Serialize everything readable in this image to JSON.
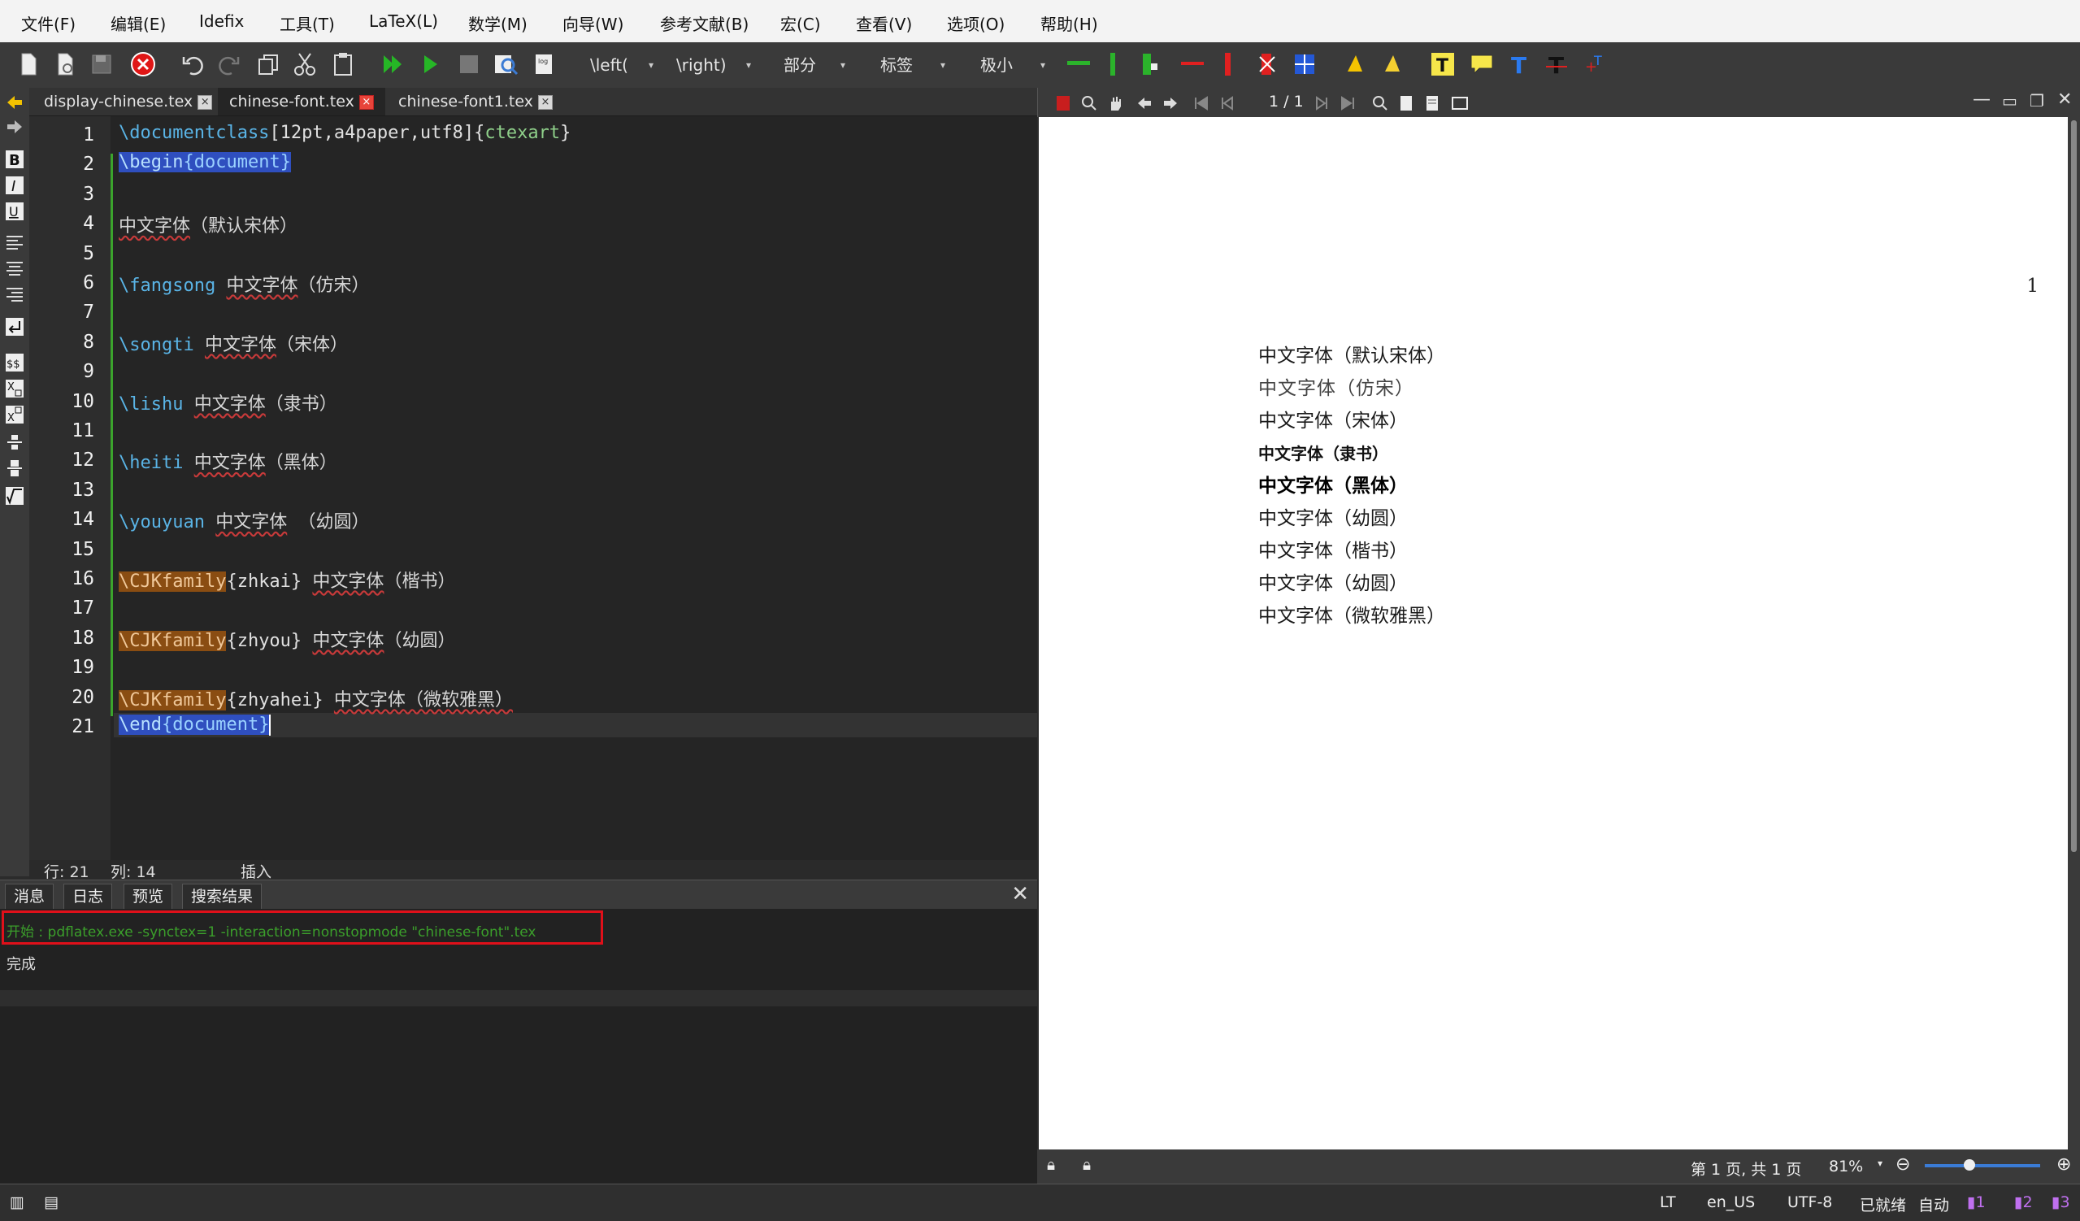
{
  "menu": [
    "文件(F)",
    "编辑(E)",
    "Idefix",
    "工具(T)",
    "LaTeX(L)",
    "数学(M)",
    "向导(W)",
    "参考文献(B)",
    "宏(C)",
    "查看(V)",
    "选项(O)",
    "帮助(H)"
  ],
  "toolbar": {
    "combos": [
      "\\left(",
      "\\right)",
      "部分",
      "标签",
      "极小"
    ],
    "icons": [
      "new-file-icon",
      "new-from-template-icon",
      "save-icon",
      "close-red-icon",
      "undo-icon",
      "redo-icon",
      "copy-icon",
      "cut-icon",
      "paste-icon",
      "build-view-icon",
      "compile-icon",
      "stop-icon",
      "view-icon",
      "log-icon"
    ]
  },
  "tabs": [
    {
      "label": "display-chinese.tex",
      "active": false
    },
    {
      "label": "chinese-font.tex",
      "active": true
    },
    {
      "label": "chinese-font1.tex",
      "active": false
    }
  ],
  "editor": {
    "line_numbers": [
      "1",
      "2",
      "3",
      "4",
      "5",
      "6",
      "7",
      "8",
      "9",
      "10",
      "11",
      "12",
      "13",
      "14",
      "15",
      "16",
      "17",
      "18",
      "19",
      "20",
      "21"
    ],
    "lines": [
      {
        "parts": [
          {
            "t": "\\documentclass",
            "c": "cmd"
          },
          {
            "t": "[12pt,a4paper,utf8]",
            "c": "brace"
          },
          {
            "t": "{",
            "c": "brace"
          },
          {
            "t": "ctexart",
            "c": "arg"
          },
          {
            "t": "}",
            "c": "brace"
          }
        ]
      },
      {
        "parts": [
          {
            "t": "\\begin",
            "c": "env-cmd"
          },
          {
            "t": "{",
            "c": "env"
          },
          {
            "t": "document",
            "c": "env"
          },
          {
            "t": "}",
            "c": "env"
          }
        ]
      },
      {
        "parts": []
      },
      {
        "parts": [
          {
            "t": "中文字体",
            "c": "cjk wavy"
          },
          {
            "t": "（默认宋体）",
            "c": "cjk"
          }
        ]
      },
      {
        "parts": []
      },
      {
        "parts": [
          {
            "t": "\\fangsong",
            "c": "cmd"
          },
          {
            "t": " ",
            "c": "brace"
          },
          {
            "t": "中文字体",
            "c": "cjk wavy"
          },
          {
            "t": "（仿宋）",
            "c": "cjk"
          }
        ]
      },
      {
        "parts": []
      },
      {
        "parts": [
          {
            "t": "\\songti",
            "c": "cmd"
          },
          {
            "t": " ",
            "c": "brace"
          },
          {
            "t": "中文字体",
            "c": "cjk wavy"
          },
          {
            "t": "（宋体）",
            "c": "cjk"
          }
        ]
      },
      {
        "parts": []
      },
      {
        "parts": [
          {
            "t": "\\lishu",
            "c": "cmd"
          },
          {
            "t": " ",
            "c": "brace"
          },
          {
            "t": "中文字体",
            "c": "cjk wavy"
          },
          {
            "t": "（隶书）",
            "c": "cjk"
          }
        ]
      },
      {
        "parts": []
      },
      {
        "parts": [
          {
            "t": "\\heiti",
            "c": "cmd"
          },
          {
            "t": " ",
            "c": "brace"
          },
          {
            "t": "中文字体",
            "c": "cjk wavy"
          },
          {
            "t": "（黑体）",
            "c": "cjk"
          }
        ]
      },
      {
        "parts": []
      },
      {
        "parts": [
          {
            "t": "\\youyuan",
            "c": "cmd"
          },
          {
            "t": " ",
            "c": "brace"
          },
          {
            "t": "中文字体",
            "c": "cjk wavy"
          },
          {
            "t": " （幼圆）",
            "c": "cjk"
          }
        ]
      },
      {
        "parts": []
      },
      {
        "parts": [
          {
            "t": "\\CJKfamily",
            "c": "orange"
          },
          {
            "t": "{zhkai}",
            "c": "brace"
          },
          {
            "t": " ",
            "c": "brace"
          },
          {
            "t": "中文字体",
            "c": "cjk wavy"
          },
          {
            "t": "（楷书）",
            "c": "cjk"
          }
        ]
      },
      {
        "parts": []
      },
      {
        "parts": [
          {
            "t": "\\CJKfamily",
            "c": "orange"
          },
          {
            "t": "{zhyou}",
            "c": "brace"
          },
          {
            "t": " ",
            "c": "brace"
          },
          {
            "t": "中文字体",
            "c": "cjk wavy"
          },
          {
            "t": "（幼圆）",
            "c": "cjk"
          }
        ]
      },
      {
        "parts": []
      },
      {
        "parts": [
          {
            "t": "\\CJKfamily",
            "c": "orange"
          },
          {
            "t": "{zhyahei}",
            "c": "brace"
          },
          {
            "t": " ",
            "c": "brace"
          },
          {
            "t": "中文字体",
            "c": "cjk wavy"
          },
          {
            "t": "（微软雅黑）",
            "c": "cjk wavy"
          }
        ]
      },
      {
        "parts": [
          {
            "t": "\\end",
            "c": "env-cmd"
          },
          {
            "t": "{",
            "c": "env"
          },
          {
            "t": "document",
            "c": "env"
          },
          {
            "t": "}",
            "c": "env"
          }
        ]
      }
    ],
    "status": {
      "row": "行: 21",
      "col": "列: 14",
      "mode": "插入"
    }
  },
  "panel": {
    "tabs": [
      "消息",
      "日志",
      "预览",
      "搜索结果"
    ],
    "message": "开始 : pdflatex.exe -synctex=1 -interaction=nonstopmode \"chinese-font\".tex",
    "done": "完成"
  },
  "viewer": {
    "page_indicator": "1 / 1",
    "page_number": "1",
    "lines": [
      {
        "text": "中文字体（默认宋体）",
        "weight": "normal"
      },
      {
        "text": "中文字体（仿宋）",
        "weight": "light"
      },
      {
        "text": "中文字体（宋体）",
        "weight": "normal"
      },
      {
        "text": "中文字体（隶书）",
        "weight": "bold"
      },
      {
        "text": "中文字体（黑体）",
        "weight": "heavy"
      },
      {
        "text": "中文字体（幼圆）",
        "weight": "normal"
      },
      {
        "text": "中文字体（楷书）",
        "weight": "normal"
      },
      {
        "text": "中文字体（幼圆）",
        "weight": "normal"
      },
      {
        "text": "中文字体（微软雅黑）",
        "weight": "normal"
      }
    ],
    "status": {
      "pages": "第 1 页, 共 1 页",
      "zoom": "81%"
    }
  },
  "statusbar": {
    "lt": "LT",
    "lang": "en_US",
    "encoding": "UTF-8",
    "ready": "已就绪",
    "auto": "自动"
  },
  "colors": {
    "accent": "#2f4fbf",
    "message_green": "#3b9f2b",
    "highlight_red": "#e0101a"
  }
}
